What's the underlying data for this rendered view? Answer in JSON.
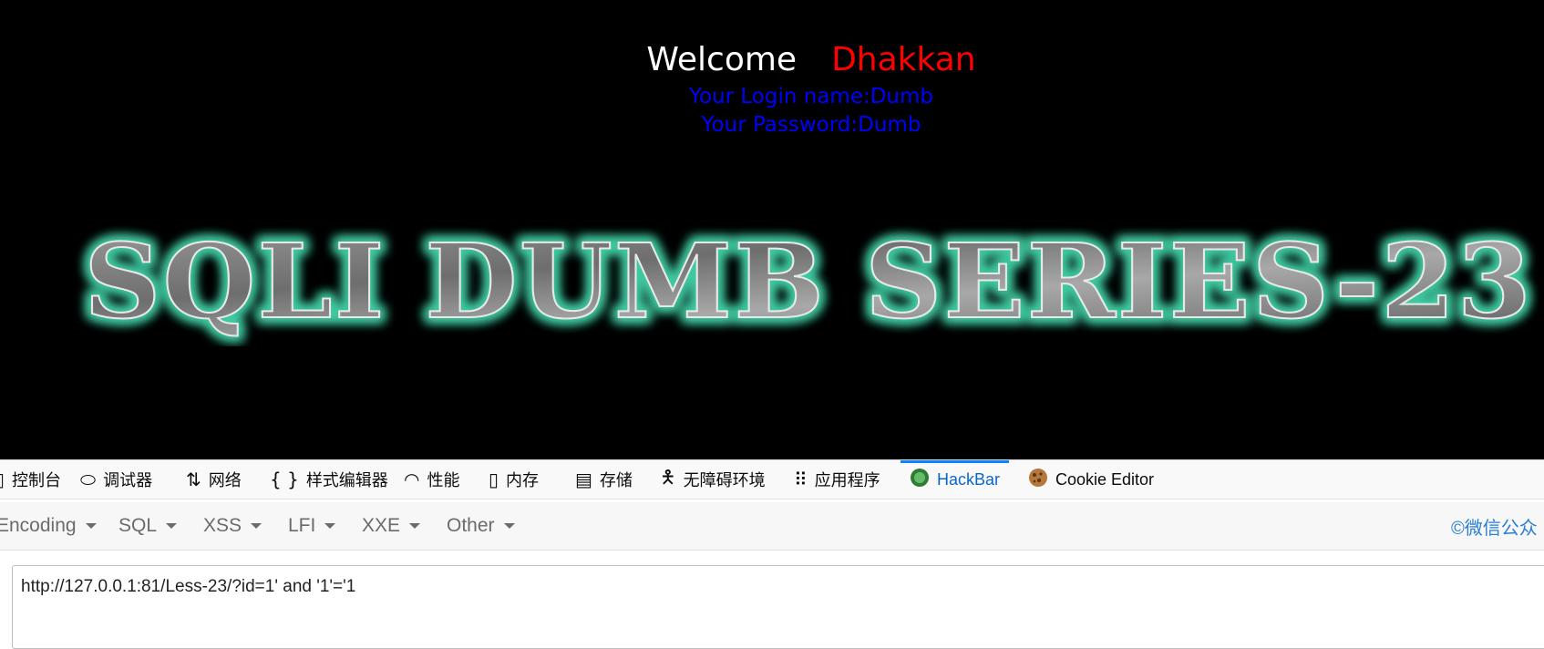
{
  "page": {
    "welcome_word": "Welcome",
    "user_name": "Dhakkan",
    "login_line": "Your Login name:Dumb",
    "password_line": "Your Password:Dumb",
    "banner_title": "SQLI DUMB SERIES-23"
  },
  "devtools": {
    "tabs": [
      {
        "label": "控制台",
        "icon": "console-icon"
      },
      {
        "label": "调试器",
        "icon": "debugger-icon"
      },
      {
        "label": "网络",
        "icon": "network-icon"
      },
      {
        "label": "样式编辑器",
        "icon": "style-editor-icon"
      },
      {
        "label": "性能",
        "icon": "performance-icon"
      },
      {
        "label": "内存",
        "icon": "memory-icon"
      },
      {
        "label": "存储",
        "icon": "storage-icon"
      },
      {
        "label": "无障碍环境",
        "icon": "accessibility-icon"
      },
      {
        "label": "应用程序",
        "icon": "application-icon"
      },
      {
        "label": "HackBar",
        "icon": "hackbar-icon",
        "active": true
      },
      {
        "label": "Cookie Editor",
        "icon": "cookie-icon"
      }
    ]
  },
  "hackbar": {
    "menus": [
      "Encoding",
      "SQL",
      "XSS",
      "LFI",
      "XXE",
      "Other"
    ],
    "watermark": "©微信公众",
    "url_value": "http://127.0.0.1:81/Less-23/?id=1' and '1'='1"
  },
  "colors": {
    "page_bg": "#000000",
    "welcome": "#ffffff",
    "user_name": "#ff0000",
    "info": "#0000ff",
    "banner_glow": "#3fc9a0",
    "active_tab": "#0a67c8"
  }
}
